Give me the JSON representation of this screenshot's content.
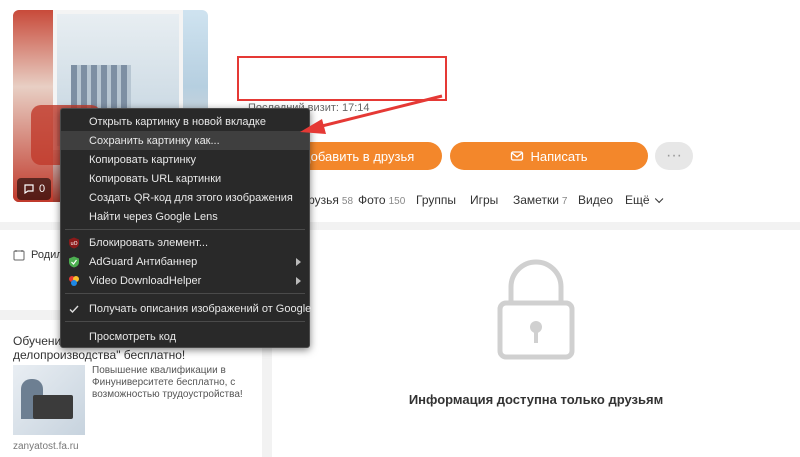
{
  "profile": {
    "last_visit": "Последний визит: 17:14",
    "comment_count": "0"
  },
  "actions": {
    "add_friend": "Добавить в друзья",
    "write": "Написать",
    "more": "···"
  },
  "nav": {
    "items": [
      {
        "label": "Друзья",
        "count": "58"
      },
      {
        "label": "Фото",
        "count": "150"
      },
      {
        "label": "Группы",
        "count": ""
      },
      {
        "label": "Игры",
        "count": ""
      },
      {
        "label": "Заметки",
        "count": "7"
      },
      {
        "label": "Видео",
        "count": ""
      },
      {
        "label": "Ещё",
        "count": ""
      }
    ]
  },
  "left": {
    "row_label": "Родил"
  },
  "ad": {
    "title": "Обучение \"Документационное обеспечение и делопроизводство\" бесплатно!",
    "title_line1": "Обучение",
    "title_line2": "делопроизводства\" бесплатно!",
    "text": "Повышение квалификации в Финуниверситете бесплатно, с возможностью трудоустройства!",
    "domain": "zanyatost.fa.ru"
  },
  "locked": {
    "message": "Информация доступна только друзьям"
  },
  "context_menu": {
    "items": [
      {
        "label": "Открыть картинку в новой вкладке"
      },
      {
        "label": "Сохранить картинку как..."
      },
      {
        "label": "Копировать картинку"
      },
      {
        "label": "Копировать URL картинки"
      },
      {
        "label": "Создать QR-код для этого изображения"
      },
      {
        "label": "Найти через Google Lens"
      },
      {
        "label": "Блокировать элемент..."
      },
      {
        "label": "AdGuard Антибаннер"
      },
      {
        "label": "Video DownloadHelper"
      },
      {
        "label": "Получать описания изображений от Google"
      },
      {
        "label": "Просмотреть код"
      }
    ]
  },
  "colors": {
    "accent": "#f3872b",
    "highlight": "#e53935",
    "menu_bg": "#292929"
  }
}
